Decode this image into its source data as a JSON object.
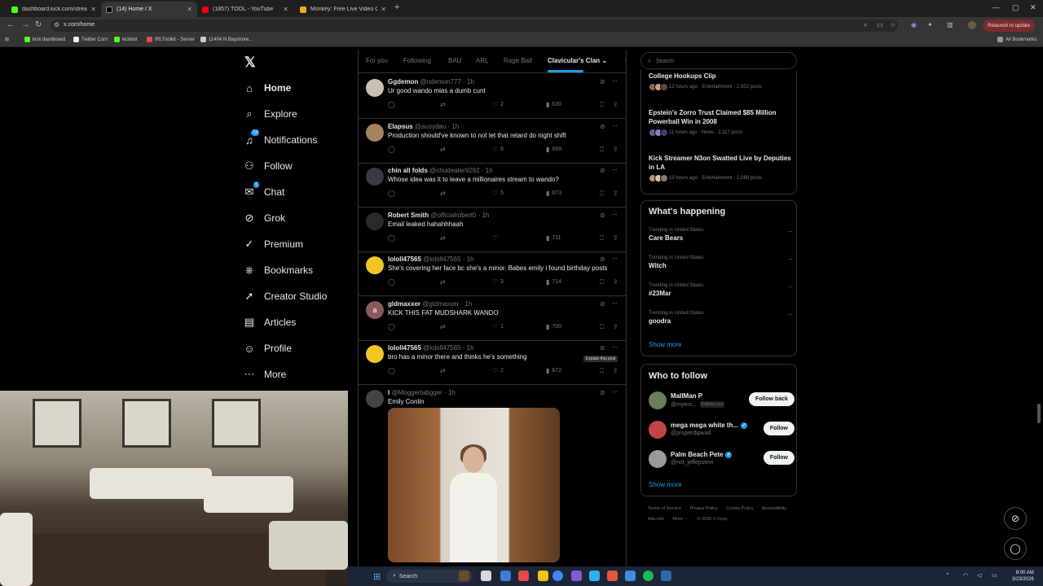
{
  "browser": {
    "tabs": [
      {
        "label": "dashboard.kick.com/stream",
        "active": false,
        "color": "#53fc18"
      },
      {
        "label": "(14) Home / X",
        "active": true,
        "color": "#000000"
      },
      {
        "label": "(1857) TOOL - YouTube",
        "active": false,
        "color": "#ff0000"
      },
      {
        "label": "Monkey: Free Live Video C",
        "active": false,
        "color": "#f5a623"
      }
    ],
    "url": "x.com/home",
    "relaunch_label": "Relaunch to update",
    "bookmarks": [
      "kick dashboard",
      "Twitter Com",
      "kickbot",
      "IRLToolkit - Server",
      "11404 N Bayshore..."
    ],
    "all_bookmarks": "All Bookmarks"
  },
  "sidebar": {
    "logo": "𝕏",
    "items": [
      {
        "label": "Home",
        "icon": "home-icon",
        "glyph": "⌂",
        "bold": true
      },
      {
        "label": "Explore",
        "icon": "search-icon",
        "glyph": "⌕"
      },
      {
        "label": "Notifications",
        "icon": "bell-icon",
        "glyph": "♫",
        "badge": "13"
      },
      {
        "label": "Follow",
        "icon": "follow-icon",
        "glyph": "⚇"
      },
      {
        "label": "Chat",
        "icon": "mail-icon",
        "glyph": "✉",
        "badge": "1"
      },
      {
        "label": "Grok",
        "icon": "grok-icon",
        "glyph": "⊘"
      },
      {
        "label": "Premium",
        "icon": "premium-icon",
        "glyph": "✓"
      },
      {
        "label": "Bookmarks",
        "icon": "bookmark-icon",
        "glyph": "⎈"
      },
      {
        "label": "Creator Studio",
        "icon": "rocket-icon",
        "glyph": "➚"
      },
      {
        "label": "Articles",
        "icon": "article-icon",
        "glyph": "▤"
      },
      {
        "label": "Profile",
        "icon": "profile-icon",
        "glyph": "☺"
      },
      {
        "label": "More",
        "icon": "more-icon",
        "glyph": "⋯"
      }
    ]
  },
  "feed": {
    "tabs": [
      "For you",
      "Following",
      "BAU",
      "ARL",
      "Rage Bait",
      "Clavicular's Clan",
      "I"
    ],
    "active_tab": "Clavicular's Clan",
    "posts": [
      {
        "name": "Ggdemon",
        "handle": "@ndemon777",
        "time": "1h",
        "text": "Ur good wando mias a dumb cunt",
        "replies": "",
        "reposts": "",
        "likes": "2",
        "views": "630",
        "avatar_color": "#c9c2b4"
      },
      {
        "name": "Elapsus",
        "handle": "@ausydau",
        "time": "1h",
        "text": "Production should've known to not let that retard do night shift",
        "replies": "",
        "reposts": "",
        "likes": "6",
        "views": "668",
        "avatar_color": "#a3845d"
      },
      {
        "name": "chin all folds",
        "handle": "@chudeater9292",
        "time": "1h",
        "text": "Whose idea was it to leave a millionaires stream to wando?",
        "replies": "",
        "reposts": "",
        "likes": "5",
        "views": "673",
        "avatar_color": "#3a3a45"
      },
      {
        "name": "Robert Smith",
        "handle": "@officialrobert0",
        "time": "1h",
        "text": "Email leaked hahahhhaah",
        "replies": "",
        "reposts": "",
        "likes": "",
        "views": "711",
        "avatar_color": "#2a2a2a"
      },
      {
        "name": "lololl47565",
        "handle": "@lololl47565",
        "time": "1h",
        "text": "She's covering her face bc she's a minor. Babes emily i found birthday posts",
        "replies": "",
        "reposts": "",
        "likes": "3",
        "views": "714",
        "avatar_color": "#f3c623"
      },
      {
        "name": "gldmaxxer",
        "handle": "@gldmaxxer",
        "time": "1h",
        "text": "KICK THIS FAT MUDSHARK WANDO",
        "replies": "",
        "reposts": "",
        "likes": "1",
        "views": "700",
        "avatar_color": "#8a5a5a",
        "avatar_letter": "a"
      },
      {
        "name": "lololl47565",
        "handle": "@lololl47565",
        "time": "1h",
        "text": "bro has a minor there and thinks he's something",
        "replies": "",
        "reposts": "",
        "likes": "2",
        "views": "672",
        "avatar_color": "#f3c623",
        "tooltip": "Explain this post"
      },
      {
        "name": "l",
        "handle": "@Moggertabgger",
        "time": "1h",
        "text": "Emily Conlin",
        "avatar_color": "#444444"
      }
    ]
  },
  "right": {
    "search_placeholder": "Search",
    "news": [
      {
        "title": "College Hookups Clip",
        "meta": "12 hours ago · Entertainment · 2,502 posts"
      },
      {
        "title": "Epstein's Zorro Trust Claimed $85 Million Powerball Win in 2008",
        "meta": "11 hours ago · News · 2,117 posts"
      },
      {
        "title": "Kick Streamer N3on Swatted Live by Deputies in LA",
        "meta": "13 hours ago · Entertainment · 1,080 posts"
      }
    ],
    "happening_title": "What's happening",
    "trends": [
      {
        "context": "Trending in United States",
        "name": "Care Bears"
      },
      {
        "context": "Trending in United States",
        "name": "Witch"
      },
      {
        "context": "Trending in United States",
        "name": "#23Mar"
      },
      {
        "context": "Trending in United States",
        "name": "goodra"
      }
    ],
    "show_more": "Show more",
    "wtf_title": "Who to follow",
    "who_to_follow": [
      {
        "name": "MallMan P",
        "handle": "@myers...",
        "follows_you": "Follows you",
        "button": "Follow back",
        "verified": false,
        "avatar_color": "#6b7f5a"
      },
      {
        "name": "mega mega white th...",
        "handle": "@properdipwad",
        "button": "Follow",
        "verified": true,
        "avatar_color": "#c24545"
      },
      {
        "name": "Palm Beach Pete",
        "handle": "@not_jeffepstein",
        "button": "Follow",
        "verified": true,
        "avatar_color": "#9a9a9a"
      }
    ],
    "footer": [
      "Terms of Service",
      "Privacy Policy",
      "Cookie Policy",
      "Accessibility",
      "Ads info",
      "More ···",
      "© 2026 X Corp."
    ]
  },
  "taskbar": {
    "search_label": "Search",
    "time": "8:00 AM",
    "date": "3/23/2026"
  }
}
